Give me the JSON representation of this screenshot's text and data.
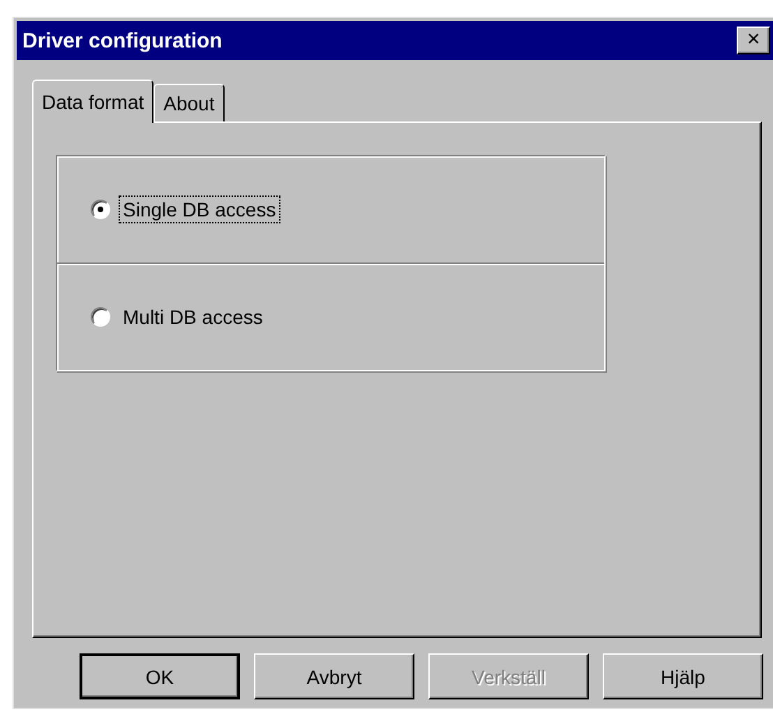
{
  "window": {
    "title": "Driver configuration",
    "close": "×"
  },
  "tabs": [
    {
      "label": "Data format",
      "selected": true
    },
    {
      "label": "About",
      "selected": false
    }
  ],
  "options": [
    {
      "label": "Single DB access",
      "selected": true,
      "focused": true
    },
    {
      "label": "Multi DB access",
      "selected": false,
      "focused": false
    }
  ],
  "buttons": [
    {
      "label": "OK",
      "default": true,
      "disabled": false
    },
    {
      "label": "Avbryt",
      "default": false,
      "disabled": false
    },
    {
      "label": "Verkställ",
      "default": false,
      "disabled": true
    },
    {
      "label": "Hjälp",
      "default": false,
      "disabled": false
    }
  ]
}
